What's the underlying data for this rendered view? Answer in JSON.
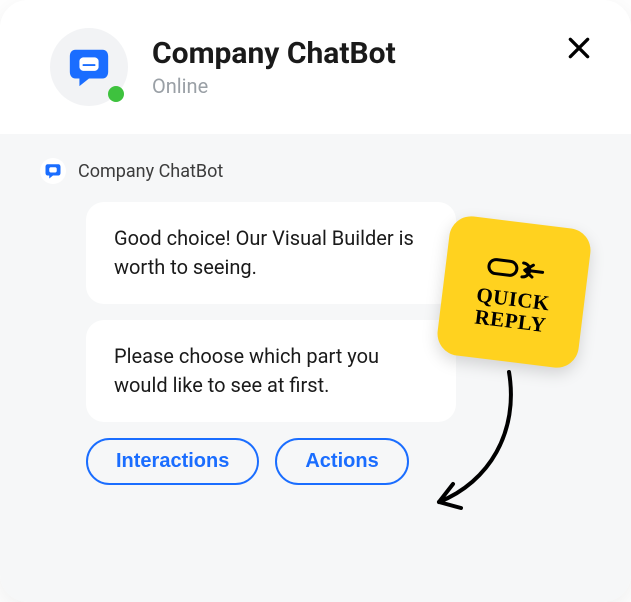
{
  "header": {
    "title": "Company ChatBot",
    "status": "Online"
  },
  "conversation": {
    "sender_name": "Company ChatBot",
    "messages": [
      "Good choice! Our Visual Builder is worth to seeing.",
      "Please choose which part you would like to see at first."
    ]
  },
  "quick_replies": [
    "Interactions",
    "Actions"
  ],
  "annotation": {
    "line1": "QUICK",
    "line2": "REPLY"
  },
  "colors": {
    "accent": "#1a6dff",
    "status_online": "#3ec23e",
    "sticker": "#ffd21f"
  }
}
